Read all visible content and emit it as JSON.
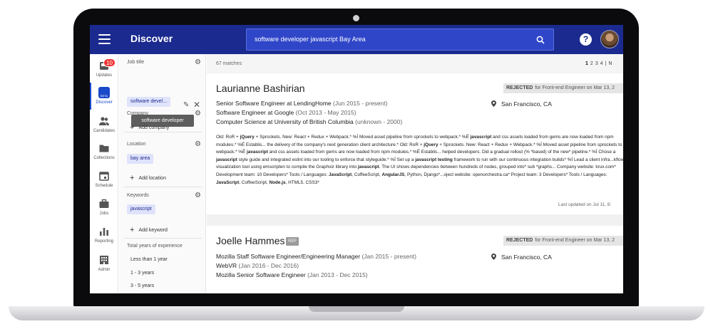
{
  "app": {
    "title": "Discover"
  },
  "search": {
    "query": "software developer javascript Bay Area"
  },
  "nav": [
    {
      "label": "Updates",
      "icon": "inbox-icon",
      "badge": "10"
    },
    {
      "label": "Discover",
      "icon": "beta-icon",
      "beta": "BETA"
    },
    {
      "label": "Candidates",
      "icon": "people-icon"
    },
    {
      "label": "Collections",
      "icon": "folder-icon"
    },
    {
      "label": "Schedule",
      "icon": "calendar-icon"
    },
    {
      "label": "Jobs",
      "icon": "briefcase-icon"
    },
    {
      "label": "Reporting",
      "icon": "bar-chart-icon"
    },
    {
      "label": "Admin",
      "icon": "building-icon"
    }
  ],
  "filters": {
    "job_title": {
      "label": "Job title",
      "chip": "software devel...",
      "tooltip": "software developer"
    },
    "company": {
      "label": "Company",
      "add": "Add company"
    },
    "location": {
      "label": "Location",
      "chip": "bay area",
      "add": "Add location"
    },
    "keywords": {
      "label": "Keywords",
      "chip": "javascript",
      "add": "Add keyword"
    },
    "experience": {
      "label": "Total years of experience",
      "options": [
        "Less than 1 year",
        "1 - 3 years",
        "3 - 5 years"
      ]
    }
  },
  "results": {
    "matches": "67 matches",
    "pages": [
      "1",
      "2",
      "3",
      "4",
      "|",
      "N"
    ],
    "candidates": [
      {
        "name": "Laurianne Bashirian",
        "status": "REJECTED",
        "status_detail": "for Front-end Engineer on Mar 13, 2",
        "location": "San Francisco, CA",
        "experience": [
          {
            "role": "Senior Software Engineer",
            "at": "at",
            "company": "LendingHome",
            "dates": "(Jun 2015 - present)"
          },
          {
            "role": "Software Engineer",
            "at": "at",
            "company": "Google",
            "dates": "(Oct 2013 - May 2015)"
          },
          {
            "role": "Computer Science",
            "at": "at",
            "company": "University of British Columbia",
            "dates": "(unknown - 2000)"
          }
        ],
        "summary": {
          "s1": "Old: RoR + ",
          "s2": "jQuery",
          "s3": " + Sprockets. New: React + Redux + Webpack.* %Í Moved asset pipeline from sprockets to webpack.* %Ë ",
          "s4": "javascript",
          "s5": " and css assets loaded from gems are now loaded from npm modules.* %Ë Establis... the delivery of the company's next generation client architecture.* Old: RoR + ",
          "s6": "jQuery",
          "s7": " + Sprockets. New: React + Redux + Webpack.* %Í Moved asset pipeline from sprockets to webpack.* %Ë ",
          "s8": "javascript",
          "s9": " and css assets loaded from gems are now loaded from npm modules.* %Ë Establis... helped developers. Did a gradual rollout (% *based) of the new* pipeline.* %Í Chose a ",
          "s10": "javascript",
          "s11": " style guide and integrated eslint into our tooling to enforce that styleguide.* %Í Set up a ",
          "s12": "javascript testing",
          "s13": " framework to run with our continuous integration builds* %Í Lead a client infra...kflow visualization tool using emscripten to compile the Graphviz library into ",
          "s14": "javascript",
          "s15": ". The UI shows dependencies between hundreds of nodes, grouped into* sub *graphs... Company website: krux.com* Development team: 10 Developers* Tools / Languages: ",
          "s16": "JavaScript",
          "s17": ", CoffeeScript, ",
          "s18": "AngularJS",
          "s19": ", Python, Django*...oject website: openorchestra.ca* Project team: 3 Developers* Tools / Languages: ",
          "s20": "JavaScript",
          "s21": ", CoffeeScript, ",
          "s22": "Node.js",
          "s23": ", HTML5, CSS3*"
        },
        "updated": "Last updated on Jul 11, 8:"
      },
      {
        "name": "Joelle Hammes",
        "ref": "REF",
        "status": "REJECTED",
        "status_detail": "for Front-end Engineer on Mar 13, 2",
        "location": "San Francisco, CA",
        "experience": [
          {
            "role": "Mozilla Staff Software Engineer/Engineering Manager",
            "dates": "(Jan 2015 - present)"
          },
          {
            "role": "WebVR",
            "dates": "(Jan 2016 - Dec 2016)"
          },
          {
            "role": "Mozilla Senior Software Engineer",
            "dates": "(Jan 2013 - Dec 2015)"
          }
        ]
      }
    ]
  },
  "colors": {
    "topbar": "#1b2a8f",
    "search": "#2f46c9",
    "accent": "#1b49c9",
    "badge": "#ee3333"
  }
}
